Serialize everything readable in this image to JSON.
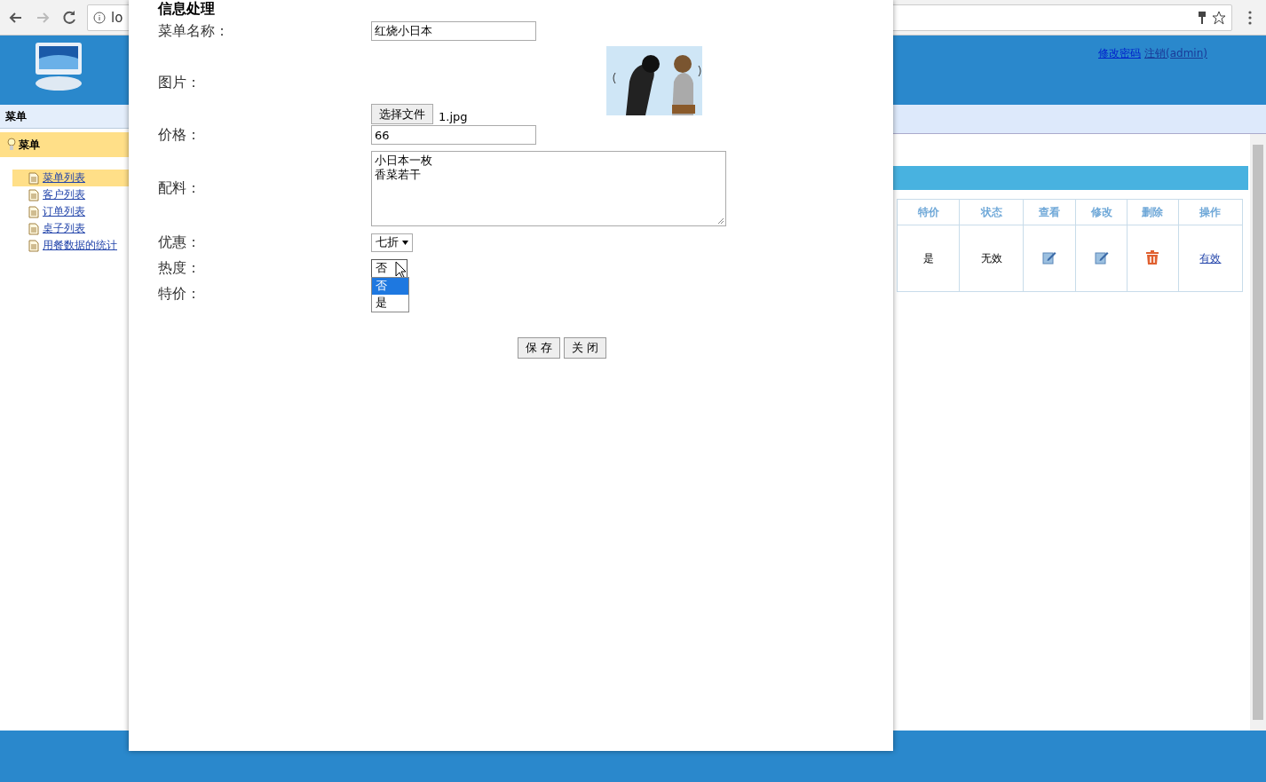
{
  "browser": {
    "address": "lo"
  },
  "header": {
    "links": [
      "修改密码",
      "注销(admin)"
    ]
  },
  "sidebar": {
    "title": "菜单",
    "section": "菜单",
    "items": [
      {
        "label": "菜单列表",
        "selected": true
      },
      {
        "label": "客户列表",
        "selected": false
      },
      {
        "label": "订单列表",
        "selected": false
      },
      {
        "label": "桌子列表",
        "selected": false
      },
      {
        "label": "用餐数据的统计",
        "selected": false
      }
    ]
  },
  "table": {
    "columns": [
      "特价",
      "状态",
      "查看",
      "修改",
      "删除",
      "操作"
    ],
    "rows": [
      [
        {
          "kind": "text",
          "text": "是"
        },
        {
          "kind": "text",
          "text": "无效"
        },
        {
          "kind": "edit"
        },
        {
          "kind": "edit"
        },
        {
          "kind": "delete"
        },
        {
          "kind": "link",
          "text": "有效"
        }
      ]
    ]
  },
  "dialog": {
    "title": "信息处理",
    "fields": [
      {
        "kind": "text",
        "label": "菜单名称：",
        "value": "红烧小日本"
      },
      {
        "label": "图片：",
        "button": "选择文件",
        "filename": "1.jpg"
      },
      {
        "kind": "text",
        "label": "价格：",
        "value": "66"
      },
      {
        "kind": "textarea",
        "label": "配料：",
        "lines": [
          "小日本一枚",
          "香菜若干"
        ]
      },
      {
        "kind": "select",
        "label": "优惠：",
        "value": "七折"
      },
      {
        "kind": "open_select",
        "label": "热度：",
        "value": "否",
        "options": [
          {
            "label": "否",
            "selected": true
          },
          {
            "label": "是",
            "selected": false
          }
        ]
      },
      {
        "kind": "empty",
        "label": "特价："
      }
    ],
    "buttons": [
      "保 存",
      "关 闭"
    ]
  }
}
